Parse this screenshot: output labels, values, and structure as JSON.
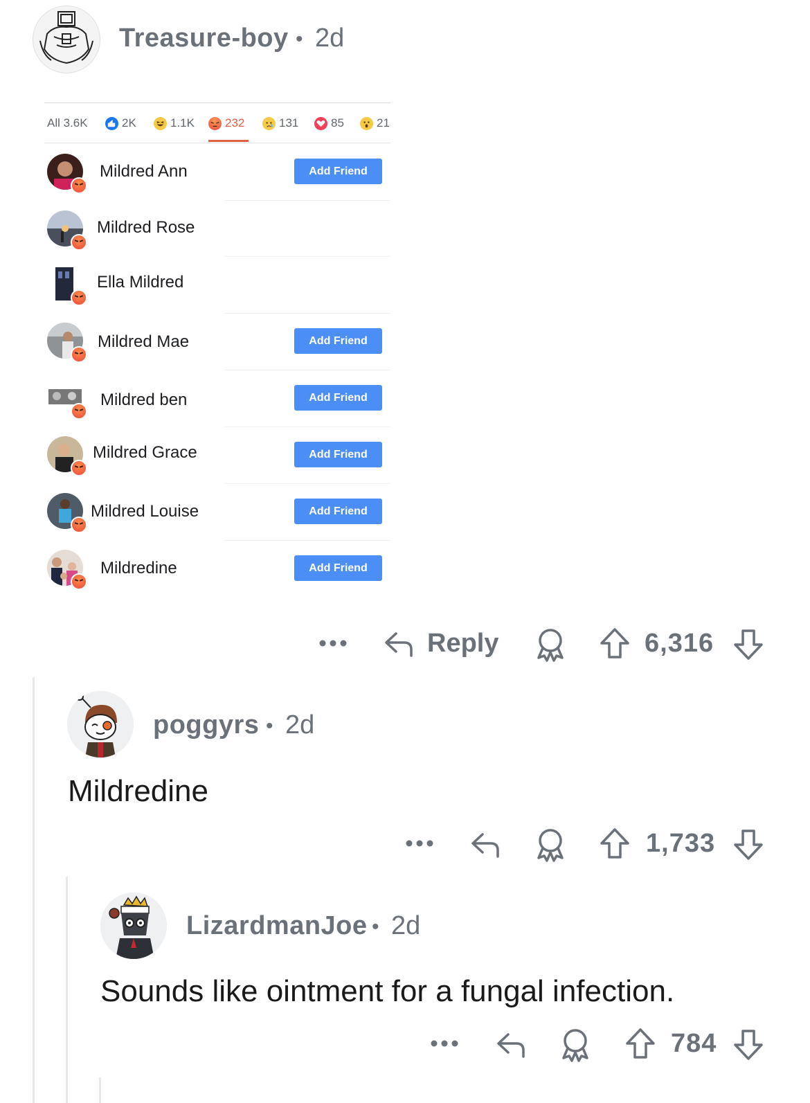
{
  "comments": [
    {
      "username": "Treasure-boy",
      "age": "2d",
      "score": "6,316",
      "reply_label": "Reply",
      "avatar_icon": "muscular-character-avatar-icon"
    },
    {
      "username": "poggyrs",
      "age": "2d",
      "body": "Mildredine",
      "score": "1,733",
      "avatar_icon": "goggles-character-avatar-icon"
    },
    {
      "username": "LizardmanJoe",
      "age": "2d",
      "body": "Sounds like ointment for a fungal infection.",
      "score": "784",
      "avatar_icon": "crowned-armored-avatar-icon"
    }
  ],
  "reactions_screenshot": {
    "tabs": [
      {
        "label": "All 3.6K",
        "icon": "none"
      },
      {
        "label": "2K",
        "icon": "like-icon"
      },
      {
        "label": "1.1K",
        "icon": "haha-icon"
      },
      {
        "label": "232",
        "icon": "angry-icon",
        "active": true
      },
      {
        "label": "131",
        "icon": "sad-icon"
      },
      {
        "label": "85",
        "icon": "love-icon"
      },
      {
        "label": "21",
        "icon": "wow-icon"
      }
    ],
    "add_friend_label": "Add Friend",
    "people": [
      {
        "name": "Mildred Ann",
        "has_button": true
      },
      {
        "name": "Mildred Rose",
        "has_button": false
      },
      {
        "name": "Ella Mildred",
        "has_button": false
      },
      {
        "name": "Mildred Mae",
        "has_button": true
      },
      {
        "name": "Mildred ben",
        "has_button": true
      },
      {
        "name": "Mildred Grace",
        "has_button": true
      },
      {
        "name": "Mildred Louise",
        "has_button": true
      },
      {
        "name": "Mildredine",
        "has_button": true
      }
    ]
  },
  "colors": {
    "text_muted": "#6b7178",
    "add_friend_blue": "#4b8ef5",
    "angry_active": "#e0603f"
  }
}
